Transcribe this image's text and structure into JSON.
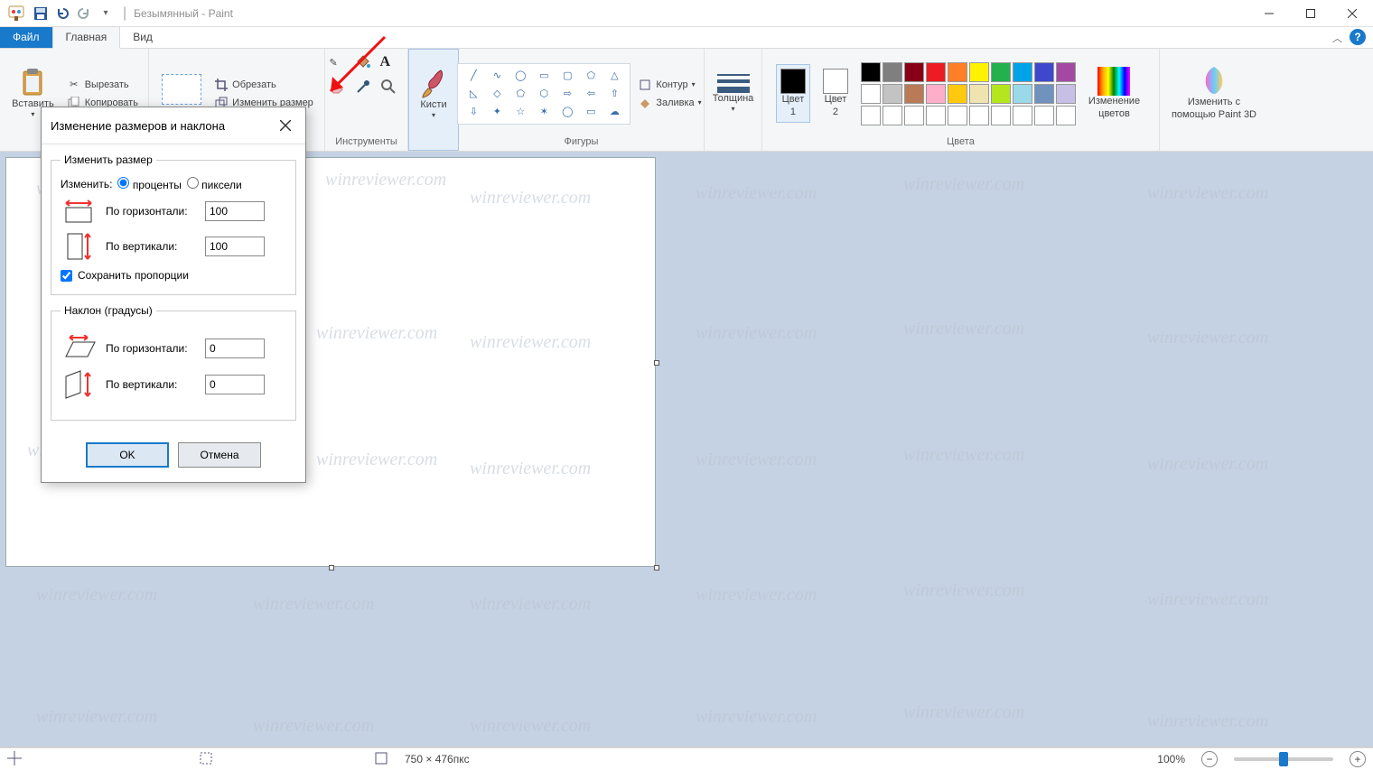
{
  "titlebar": {
    "title": "Безымянный - Paint"
  },
  "tabs": {
    "file": "Файл",
    "home": "Главная",
    "view": "Вид"
  },
  "ribbon": {
    "clipboard": {
      "paste": "Вставить",
      "cut": "Вырезать",
      "copy": "Копировать"
    },
    "image": {
      "crop": "Обрезать",
      "resize": "Изменить размер"
    },
    "tools": {
      "label": "Инструменты"
    },
    "brushes": {
      "label": "Кисти"
    },
    "shapes": {
      "label": "Фигуры",
      "outline": "Контур",
      "fill": "Заливка"
    },
    "thickness": {
      "label": "Толщина"
    },
    "colors": {
      "c1": "Цвет\n1",
      "c2": "Цвет\n2",
      "edit": "Изменение\nцветов",
      "label": "Цвета"
    },
    "paint3d": {
      "label": "Изменить с\nпомощью Paint 3D"
    }
  },
  "palette": {
    "row1": [
      "#000000",
      "#7f7f7f",
      "#880015",
      "#ed1c24",
      "#ff7f27",
      "#fff200",
      "#22b14c",
      "#00a2e8",
      "#3f48cc",
      "#a349a4"
    ],
    "row2": [
      "#ffffff",
      "#c3c3c3",
      "#b97a57",
      "#ffaec9",
      "#ffc90e",
      "#efe4b0",
      "#b5e61d",
      "#99d9ea",
      "#7092be",
      "#c8bfe7"
    ],
    "row3": [
      "#ffffff",
      "#ffffff",
      "#ffffff",
      "#ffffff",
      "#ffffff",
      "#ffffff",
      "#ffffff",
      "#ffffff",
      "#ffffff",
      "#ffffff"
    ]
  },
  "current_colors": {
    "c1": "#000000",
    "c2": "#ffffff"
  },
  "dialog": {
    "title": "Изменение размеров и наклона",
    "resize": {
      "legend": "Изменить размер",
      "bylabel": "Изменить:",
      "percent": "проценты",
      "pixels": "пиксели",
      "horiz": "По горизонтали:",
      "vert": "По вертикали:",
      "h_value": "100",
      "v_value": "100",
      "keep": "Сохранить пропорции"
    },
    "skew": {
      "legend": "Наклон (градусы)",
      "horiz": "По горизонтали:",
      "vert": "По вертикали:",
      "h_value": "0",
      "v_value": "0"
    },
    "ok": "OK",
    "cancel": "Отмена"
  },
  "status": {
    "dims": "750 × 476пкс",
    "zoom": "100%"
  },
  "watermark": "winreviewer.com"
}
